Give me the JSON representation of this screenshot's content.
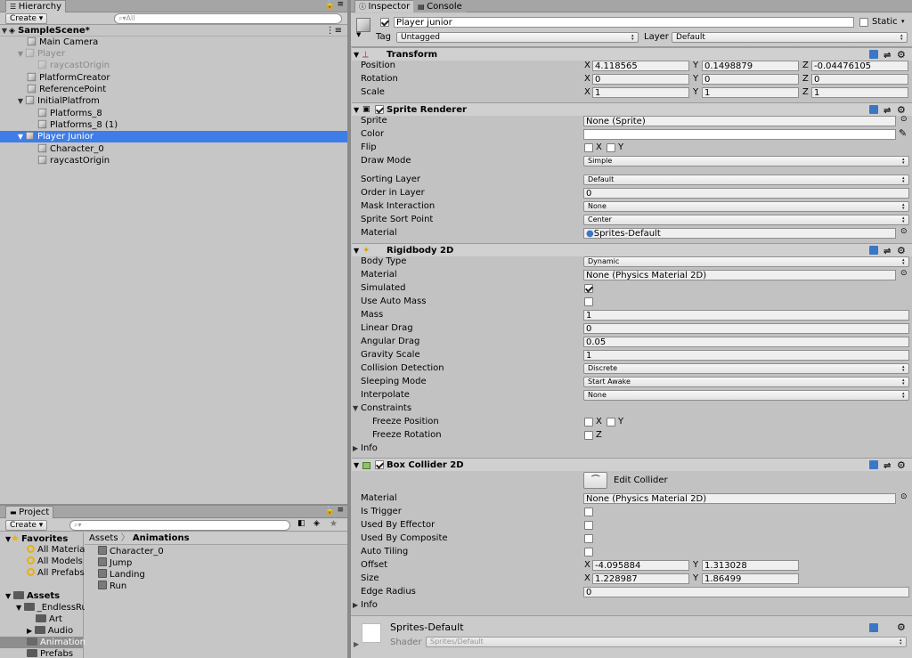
{
  "hierarchy": {
    "tab": "Hierarchy",
    "create": "Create",
    "search_placeholder": "All",
    "scene": "SampleScene*",
    "items": [
      "Main Camera",
      "Player",
      "raycastOrigin",
      "PlatformCreator",
      "ReferencePoint",
      "InitialPlatfrom",
      "Platforms_8",
      "Platforms_8 (1)",
      "Player Junior",
      "Character_0",
      "raycastOrigin"
    ]
  },
  "project": {
    "tab": "Project",
    "create": "Create",
    "favorites": "Favorites",
    "fav_items": [
      "All Material",
      "All Models",
      "All Prefabs"
    ],
    "assets": "Assets",
    "asset_items": [
      "_EndlessRu",
      "Art",
      "Audio",
      "Animations",
      "Prefabs"
    ],
    "breadcrumb_root": "Assets",
    "breadcrumb_current": "Animations",
    "files": [
      "Character_0",
      "Jump",
      "Landing",
      "Run"
    ]
  },
  "inspector": {
    "tab": "Inspector",
    "console_tab": "Console",
    "object_name": "Player junior",
    "static_label": "Static",
    "tag_label": "Tag",
    "tag_value": "Untagged",
    "layer_label": "Layer",
    "layer_value": "Default",
    "transform": {
      "title": "Transform",
      "position_label": "Position",
      "position": {
        "x": "4.118565",
        "y": "0.1498879",
        "z": "-0.04476105"
      },
      "rotation_label": "Rotation",
      "rotation": {
        "x": "0",
        "y": "0",
        "z": "0"
      },
      "scale_label": "Scale",
      "scale": {
        "x": "1",
        "y": "1",
        "z": "1"
      }
    },
    "sprite_renderer": {
      "title": "Sprite Renderer",
      "sprite_label": "Sprite",
      "sprite_value": "None (Sprite)",
      "color_label": "Color",
      "flip_label": "Flip",
      "flip_x": "X",
      "flip_y": "Y",
      "draw_mode_label": "Draw Mode",
      "draw_mode": "Simple",
      "sorting_layer_label": "Sorting Layer",
      "sorting_layer": "Default",
      "order_label": "Order in Layer",
      "order": "0",
      "mask_label": "Mask Interaction",
      "mask": "None",
      "sort_point_label": "Sprite Sort Point",
      "sort_point": "Center",
      "material_label": "Material",
      "material": "Sprites-Default"
    },
    "rigidbody": {
      "title": "Rigidbody 2D",
      "body_type_label": "Body Type",
      "body_type": "Dynamic",
      "material_label": "Material",
      "material": "None (Physics Material 2D)",
      "simulated_label": "Simulated",
      "auto_mass_label": "Use Auto Mass",
      "mass_label": "Mass",
      "mass": "1",
      "linear_drag_label": "Linear Drag",
      "linear_drag": "0",
      "angular_drag_label": "Angular Drag",
      "angular_drag": "0.05",
      "gravity_label": "Gravity Scale",
      "gravity": "1",
      "collision_label": "Collision Detection",
      "collision": "Discrete",
      "sleeping_label": "Sleeping Mode",
      "sleeping": "Start Awake",
      "interpolate_label": "Interpolate",
      "interpolate": "None",
      "constraints_label": "Constraints",
      "freeze_pos_label": "Freeze Position",
      "freeze_pos_x": "X",
      "freeze_pos_y": "Y",
      "freeze_rot_label": "Freeze Rotation",
      "freeze_rot_z": "Z",
      "info_label": "Info"
    },
    "box_collider": {
      "title": "Box Collider 2D",
      "edit_collider": "Edit Collider",
      "material_label": "Material",
      "material": "None (Physics Material 2D)",
      "is_trigger_label": "Is Trigger",
      "effector_label": "Used By Effector",
      "composite_label": "Used By Composite",
      "auto_tiling_label": "Auto Tiling",
      "offset_label": "Offset",
      "offset": {
        "x": "-4.095884",
        "y": "1.313028"
      },
      "size_label": "Size",
      "size": {
        "x": "1.228987",
        "y": "1.86499"
      },
      "edge_radius_label": "Edge Radius",
      "edge_radius": "0",
      "info_label": "Info"
    },
    "material_footer": {
      "name": "Sprites-Default",
      "shader_label": "Shader",
      "shader": "Sprites/Default"
    }
  },
  "axis_labels": {
    "x": "X",
    "y": "Y",
    "z": "Z"
  }
}
